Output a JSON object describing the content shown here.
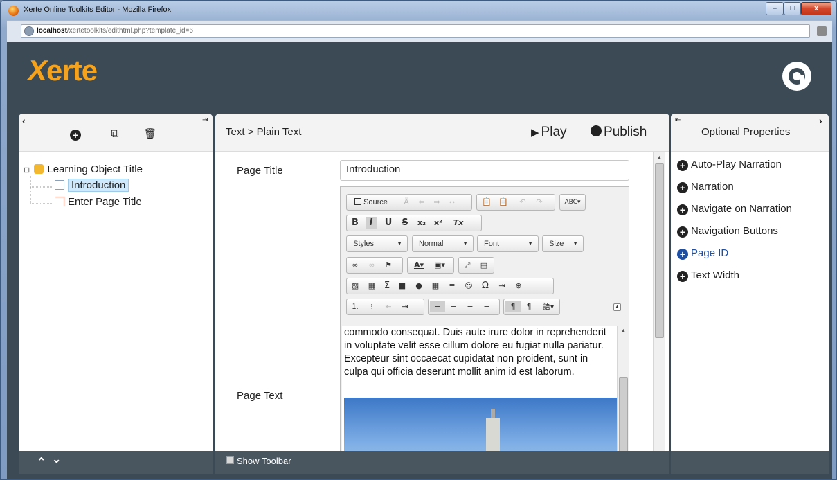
{
  "window": {
    "title": "Xerte Online Toolkits Editor - Mozilla Firefox",
    "min_label": "–",
    "max_label": "□",
    "close_label": "x"
  },
  "url": {
    "host": "localhost",
    "path": "/xertetoolkits/edithtml.php?template_id=6"
  },
  "app": {
    "logo_x": "X",
    "logo_text": "erte",
    "accent": "#f7a21b",
    "header_bg": "#3b4a55"
  },
  "left_panel": {
    "collapse_icon": "‹",
    "pin_icon": "⇥",
    "add_icon": "+",
    "duplicate_icon": "⧉",
    "delete_icon": "🗑",
    "tree": [
      {
        "label": "Learning Object Title",
        "icon": "cube-icon",
        "expand": "⊟"
      },
      {
        "label": "Introduction",
        "icon": "page-icon",
        "selected": true
      },
      {
        "label": "Enter Page Title",
        "icon": "pdf-icon"
      }
    ],
    "footer_up": "⌃",
    "footer_down": "⌄"
  },
  "center_panel": {
    "breadcrumb": "Text > Plain Text",
    "play_label": "Play",
    "publish_label": "Publish",
    "page_title_label": "Page Title",
    "page_title_value": "Introduction",
    "page_text_label": "Page Text",
    "toolbar": {
      "source_label": "Source",
      "styles_label": "Styles",
      "format_label": "Normal",
      "font_label": "Font",
      "size_label": "Size",
      "bold": "B",
      "italic": "I",
      "underline": "U",
      "strike": "S",
      "subscript": "x₂",
      "superscript": "x²",
      "remove_format": "Tx",
      "omega": "Ω",
      "sigma": "Σ"
    },
    "content_text": "commodo consequat. Duis aute irure dolor in reprehenderit in voluptate velit esse cillum dolore eu fugiat nulla pariatur. Excepteur sint occaecat cupidatat non proident, sunt in culpa qui officia deserunt mollit anim id est laborum.",
    "show_toolbar_label": "Show Toolbar"
  },
  "right_panel": {
    "title": "Optional Properties",
    "pin_icon": "⇤",
    "expand_icon": "›",
    "properties": [
      {
        "label": "Auto-Play Narration"
      },
      {
        "label": "Narration"
      },
      {
        "label": "Navigate on Narration"
      },
      {
        "label": "Navigation Buttons"
      },
      {
        "label": "Page ID",
        "highlight": true
      },
      {
        "label": "Text Width"
      }
    ]
  }
}
